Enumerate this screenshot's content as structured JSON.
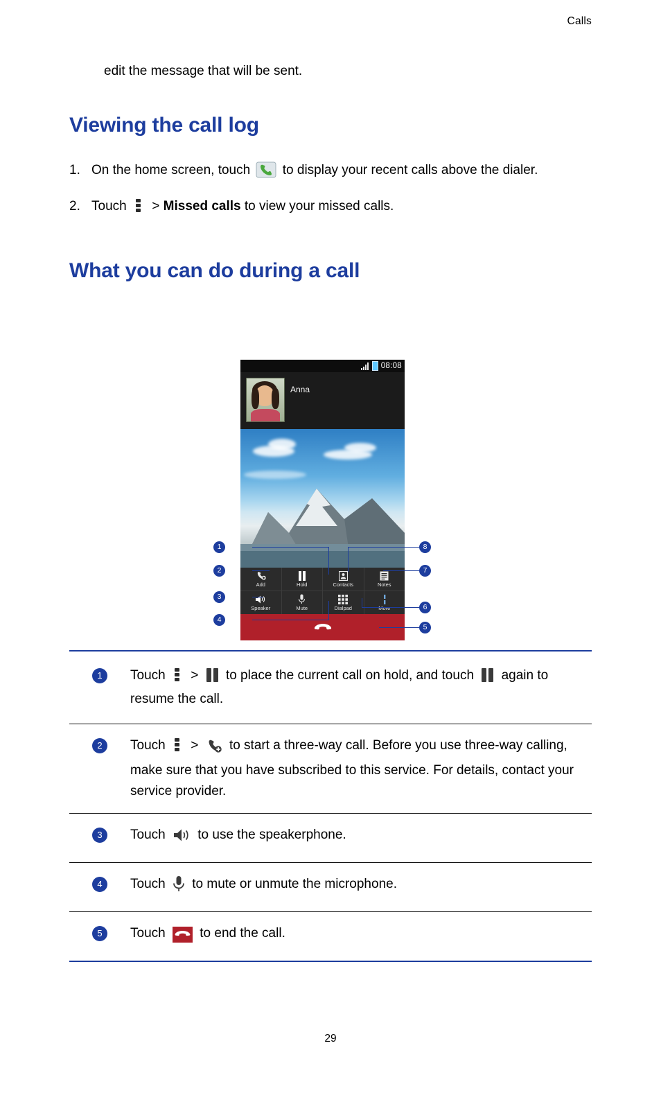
{
  "header": {
    "chapter": "Calls"
  },
  "intro": {
    "line": "edit the message that will be sent."
  },
  "sections": [
    {
      "title": "Viewing the call log"
    },
    {
      "title": "What you can do during a call"
    }
  ],
  "steps": [
    {
      "num": "1.",
      "before": "On the home screen, touch",
      "icon": "phone-icon",
      "after": "to display your recent calls above the dialer."
    },
    {
      "num": "2.",
      "before": "Touch",
      "icon": "overflow-menu-icon",
      "sep": ">",
      "bold": "Missed calls",
      "after": "to view your missed calls."
    }
  ],
  "phone": {
    "status": {
      "time": "08:08"
    },
    "caller_name": "Anna",
    "buttons_row1": [
      {
        "label": "Add",
        "icon": "add-call-icon"
      },
      {
        "label": "Hold",
        "icon": "pause-icon"
      },
      {
        "label": "Contacts",
        "icon": "contacts-icon"
      },
      {
        "label": "Notes",
        "icon": "notes-icon"
      }
    ],
    "buttons_row2": [
      {
        "label": "Speaker",
        "icon": "speaker-icon"
      },
      {
        "label": "Mute",
        "icon": "microphone-icon"
      },
      {
        "label": "Dialpad",
        "icon": "dialpad-icon"
      },
      {
        "label": "More",
        "icon": "more-icon"
      }
    ],
    "end_call": {
      "icon": "end-call-icon"
    },
    "callouts": [
      "1",
      "2",
      "3",
      "4",
      "5",
      "6",
      "7",
      "8"
    ]
  },
  "legend": [
    {
      "num": "1",
      "t1": "Touch",
      "i1": "overflow-menu-icon",
      "sep": ">",
      "i2": "pause-icon",
      "t2": "to place the current call on hold, and touch",
      "i3": "pause-icon",
      "t3": "again to resume the call."
    },
    {
      "num": "2",
      "t1": "Touch",
      "i1": "overflow-menu-icon",
      "sep": ">",
      "i2": "add-call-icon",
      "t2": "to start a three-way call. Before you use three-way calling, make sure that you have subscribed to this service. For details, contact your service provider."
    },
    {
      "num": "3",
      "t1": "Touch",
      "i1": "speaker-icon",
      "t2": "to use the speakerphone."
    },
    {
      "num": "4",
      "t1": "Touch",
      "i1": "microphone-icon",
      "t2": "to mute or unmute the microphone."
    },
    {
      "num": "5",
      "t1": "Touch",
      "i1": "end-call-icon",
      "t2": "to end the call."
    }
  ],
  "footer": {
    "page_number": "29"
  },
  "colors": {
    "heading": "#1d3d9e",
    "badge": "#1d3d9e",
    "end_call": "#b0202a"
  }
}
